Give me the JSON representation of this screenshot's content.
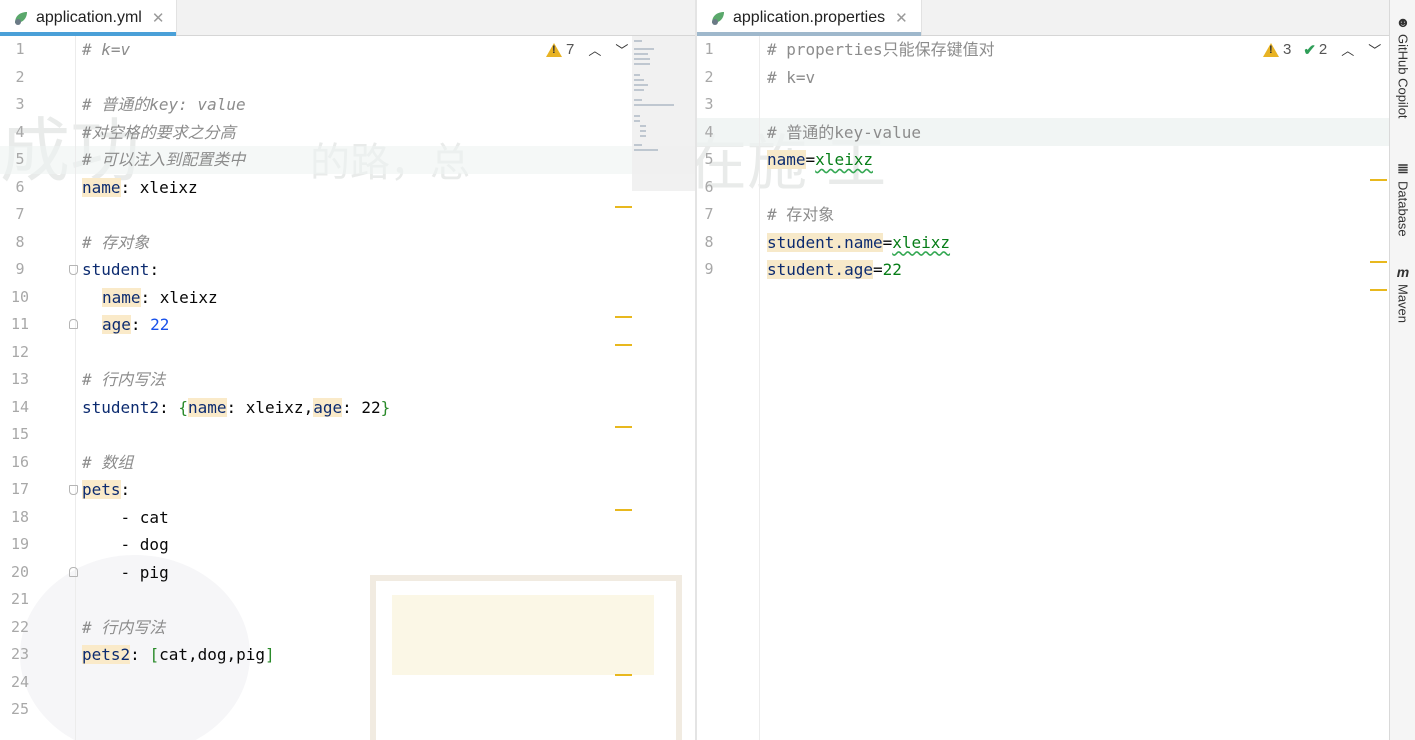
{
  "left_editor": {
    "tab": {
      "filename": "application.yml",
      "close": "✕"
    },
    "inspection": {
      "warnings": "7"
    },
    "line_numbers": [
      "1",
      "2",
      "3",
      "4",
      "5",
      "6",
      "7",
      "8",
      "9",
      "10",
      "11",
      "12",
      "13",
      "14",
      "15",
      "16",
      "17",
      "18",
      "19",
      "20",
      "21",
      "22",
      "23",
      "24",
      "25"
    ],
    "code": {
      "l1": "# k=v",
      "l3_comment": "# 普通的key: value",
      "l4_comment": "#对空格的要求之分高",
      "l5_comment": "# 可以注入到配置类中",
      "l6_key": "name",
      "l6_rest": ": xleixz",
      "l8_comment": "# 存对象",
      "l9_key": "student",
      "l9_rest": ":",
      "l10_key": "name",
      "l10_rest": ": xleixz",
      "l11_key": "age",
      "l11_sep": ": ",
      "l11_num": "22",
      "l13_comment": "# 行内写法",
      "l14_key": "student2",
      "l14_a": ": ",
      "l14_open": "{",
      "l14_k1": "name",
      "l14_b": ": xleixz,",
      "l14_k2": "age",
      "l14_c": ": 22",
      "l14_close": "}",
      "l16_comment": "# 数组",
      "l17_key": "pets",
      "l17_rest": ":",
      "l18": "    - cat",
      "l19": "    - dog",
      "l20": "    - pig",
      "l22_comment": "# 行内写法",
      "l23_key": "pets2",
      "l23_a": ": ",
      "l23_open": "[",
      "l23_mid": "cat,dog,pig",
      "l23_close": "]"
    }
  },
  "right_editor": {
    "tab": {
      "filename": "application.properties",
      "close": "✕"
    },
    "inspection": {
      "warnings": "3",
      "weak_warnings": "2"
    },
    "line_numbers": [
      "1",
      "2",
      "3",
      "4",
      "5",
      "6",
      "7",
      "8",
      "9"
    ],
    "code": {
      "l1": "# properties只能保存键值对",
      "l2": "# k=v",
      "l4": "# 普通的key-value",
      "l5_key": "name",
      "l5_eq": "=",
      "l5_val": "xleixz",
      "l7": "# 存对象",
      "l8_key": "student.name",
      "l8_eq": "=",
      "l8_val": "xleixz",
      "l9_key": "student.age",
      "l9_eq": "=",
      "l9_val": "22"
    }
  },
  "side_tools": [
    "GitHub Copilot",
    "Database",
    "Maven"
  ]
}
